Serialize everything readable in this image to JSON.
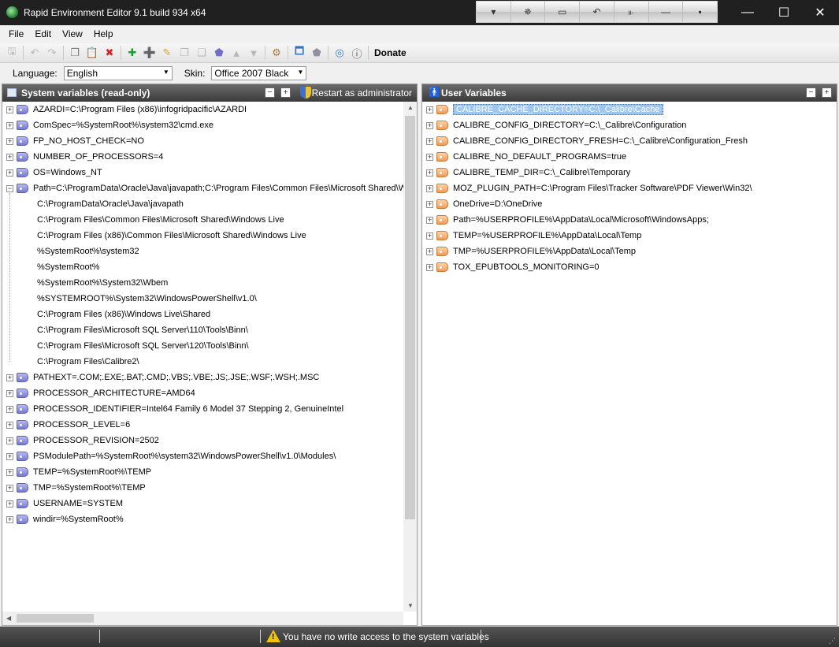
{
  "window": {
    "title": "Rapid Environment Editor 9.1 build 934 x64",
    "quick_buttons": [
      "chevron-down-icon",
      "pin-icon",
      "window-icon",
      "undo-icon",
      "plug-icon",
      "minimize-icon",
      "dot-icon"
    ]
  },
  "menu": [
    "File",
    "Edit",
    "View",
    "Help"
  ],
  "toolbar": {
    "donate_label": "Donate"
  },
  "options": {
    "language_label": "Language:",
    "language_value": "English",
    "skin_label": "Skin:",
    "skin_value": "Office 2007 Black"
  },
  "system_panel": {
    "title": "System variables (read-only)",
    "restart_label": "Restart as administrator",
    "variables": [
      "AZARDI=C:\\Program Files (x86)\\infogridpacific\\AZARDI",
      "ComSpec=%SystemRoot%\\system32\\cmd.exe",
      "FP_NO_HOST_CHECK=NO",
      "NUMBER_OF_PROCESSORS=4",
      "OS=Windows_NT",
      "Path=C:\\ProgramData\\Oracle\\Java\\javapath;C:\\Program Files\\Common Files\\Microsoft Shared\\Wi",
      "PATHEXT=.COM;.EXE;.BAT;.CMD;.VBS;.VBE;.JS;.JSE;.WSF;.WSH;.MSC",
      "PROCESSOR_ARCHITECTURE=AMD64",
      "PROCESSOR_IDENTIFIER=Intel64 Family 6 Model 37 Stepping 2, GenuineIntel",
      "PROCESSOR_LEVEL=6",
      "PROCESSOR_REVISION=2502",
      "PSModulePath=%SystemRoot%\\system32\\WindowsPowerShell\\v1.0\\Modules\\",
      "TEMP=%SystemRoot%\\TEMP",
      "TMP=%SystemRoot%\\TEMP",
      "USERNAME=SYSTEM",
      "windir=%SystemRoot%"
    ],
    "path_entries": [
      "C:\\ProgramData\\Oracle\\Java\\javapath",
      "C:\\Program Files\\Common Files\\Microsoft Shared\\Windows Live",
      "C:\\Program Files (x86)\\Common Files\\Microsoft Shared\\Windows Live",
      "%SystemRoot%\\system32",
      "%SystemRoot%",
      "%SystemRoot%\\System32\\Wbem",
      "%SYSTEMROOT%\\System32\\WindowsPowerShell\\v1.0\\",
      "C:\\Program Files (x86)\\Windows Live\\Shared",
      "C:\\Program Files\\Microsoft SQL Server\\110\\Tools\\Binn\\",
      "C:\\Program Files\\Microsoft SQL Server\\120\\Tools\\Binn\\",
      "C:\\Program Files\\Calibre2\\"
    ]
  },
  "user_panel": {
    "title": "User Variables",
    "variables": [
      "CALIBRE_CACHE_DIRECTORY=C:\\_Calibre\\Cache",
      "CALIBRE_CONFIG_DIRECTORY=C:\\_Calibre\\Configuration",
      "CALIBRE_CONFIG_DIRECTORY_FRESH=C:\\_Calibre\\Configuration_Fresh",
      "CALIBRE_NO_DEFAULT_PROGRAMS=true",
      "CALIBRE_TEMP_DIR=C:\\_Calibre\\Temporary",
      "MOZ_PLUGIN_PATH=C:\\Program Files\\Tracker Software\\PDF Viewer\\Win32\\",
      "OneDrive=D:\\OneDrive",
      "Path=%USERPROFILE%\\AppData\\Local\\Microsoft\\WindowsApps;",
      "TEMP=%USERPROFILE%\\AppData\\Local\\Temp",
      "TMP=%USERPROFILE%\\AppData\\Local\\Temp",
      "TOX_EPUBTOOLS_MONITORING=0"
    ]
  },
  "status": {
    "message": "You have no write access to the system variables"
  }
}
